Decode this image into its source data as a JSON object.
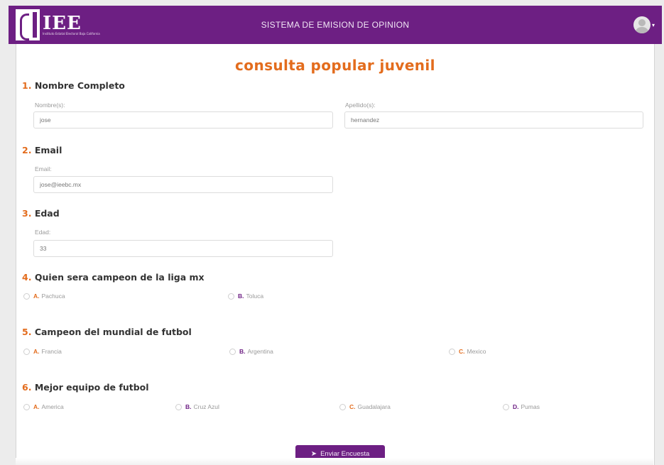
{
  "header": {
    "logo_text": "IEE",
    "logo_subtitle": "Instituto Estatal Electoral Baja California",
    "title": "SISTEMA DE EMISION DE OPINION",
    "user_caret": "▾"
  },
  "form": {
    "title": "consulta popular juvenil",
    "q1": {
      "num": "1.",
      "label": "Nombre Completo",
      "first_label": "Nombre(s):",
      "first_value": "jose",
      "last_label": "Apellido(s):",
      "last_value": "hernandez"
    },
    "q2": {
      "num": "2.",
      "label": "Email",
      "field_label": "Email:",
      "value": "jose@ieebc.mx"
    },
    "q3": {
      "num": "3.",
      "label": "Edad",
      "field_label": "Edad:",
      "value": "33"
    },
    "q4": {
      "num": "4.",
      "label": "Quien sera campeon de la liga mx",
      "options": [
        {
          "letter": "A.",
          "text": "Pachuca"
        },
        {
          "letter": "B.",
          "text": "Toluca"
        }
      ]
    },
    "q5": {
      "num": "5.",
      "label": "Campeon del mundial de futbol",
      "options": [
        {
          "letter": "A.",
          "text": "Francia"
        },
        {
          "letter": "B.",
          "text": "Argentina"
        },
        {
          "letter": "C.",
          "text": "Mexico"
        }
      ]
    },
    "q6": {
      "num": "6.",
      "label": "Mejor equipo de futbol",
      "options": [
        {
          "letter": "A.",
          "text": "America"
        },
        {
          "letter": "B.",
          "text": "Cruz Azul"
        },
        {
          "letter": "C.",
          "text": "Guadalajara"
        },
        {
          "letter": "D.",
          "text": "Pumas"
        }
      ]
    },
    "submit_label": "Enviar Encuesta",
    "submit_icon": "➤"
  },
  "colors": {
    "brand": "#6d1f83",
    "accent": "#e36c1d"
  },
  "icons": {
    "logo": "iee-logo-icon",
    "avatar": "user-avatar-icon",
    "send": "send-icon"
  }
}
